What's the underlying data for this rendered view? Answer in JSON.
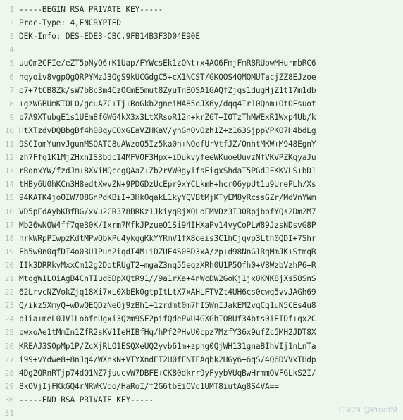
{
  "editor": {
    "lines": [
      "-----BEGIN RSA PRIVATE KEY-----",
      "Proc-Type: 4,ENCRYPTED",
      "DEK-Info: DES-EDE3-CBC,9FB14B3F3D04E90E",
      "",
      "uuQm2CFIe/eZT5pNyQ6+K1Uap/FYWcsEk1zONt+x4AO6FmjFmR8RUpwMHurmbRC6",
      "hqyoiv8vgpQgQRPYMzJ3QgS9kUCGdgC5+cX1NCST/GKQOS4QMQMUTacjZZ8EJzoe",
      "o7+7tCB8Zk/sW7b8c3m4CzOCmE5mut8ZyuTnBOSA1GAQfZjqs1dugHjZ1t17m1db",
      "+gzWGBUmKTOLO/gcuAZC+Tj+BoGkb2gneiMA85oJX6y/dqq4Ir10Qom+OtOFsuot",
      "b7A9XTubgE1s1UEm8fGW64kX3x3LtXRsoR12n+krZ6T+IOTzThMWExR1Wxp4Ub/k",
      "HtXTzdvDQBbgBf4h08qyCOxGEaVZHKaV/ynGnOvOzh1Z+z163SjppVPKO7H4bdLg",
      "9SCIomYunvJgunMSOATC8uAWzoQ5Iz5ka0h+NOofUrVtfJZ/OnhtMKW+M948EgnY",
      "zh7Ffq1K1MjZHxnIS3bdc14MFVOF3Hpx+iDukvyfeeWKuoeUuvzNfVKVPZKqyaJu",
      "rRqnxYW/fzdJm+8XViMQccgQAaZ+Zb2rVW0gyifsEigxShdaT5PGdJFKKVLS+bD1",
      "tHBy6U0hKCn3H8edtXwvZN+9PDGDzUcEpr9xYCLkmH+hcr06ypUt1u9UrePLh/Xs",
      "94KATK4joOIW7O8GnPdKBiI+3Hk0qakL1kyYQVBtMjKTyEM8yRcssGZr/MdVnYWm",
      "VD5pEdAybKBfBG/xVu2CR378BRKz1JkiyqRjXQLoFMVDz3I30RpjbpfYQs2Dm2M7",
      "Mb26wNQW4ff7qe30K/Ixrm7MfkJPzueQ1Si94IHXaPv14vyCoPLW89JzsNDsvG8P",
      "hrkWRpPIwpzKdtMPwQbkPu4ykqgKkYYRmV1fX8oeis3C1hCjqvp3Lth0QDI+7Shr",
      "Fb5w0n0qfDT4o03U1Pun2iqdI4M+iDZUF4S0BD3xA/zp+d98NnG1RqMmJK+StmqR",
      "IIk3DRRkvMxxCm12g2DotRUgT2+mgaZ3nq55eqzXRh0U1P5Qfh0+V8WzbVzhP6+R",
      "MtqgW1L0iAgB4CnTIud6DpXQtR91//9a1rXa+4nWcDW2GoKj1jx0KNK8jXs58SnS",
      "62LrvcNZVokZjq18Xi7xL0XbEk0gtpItLtX7xAHLFTVZt4UH6cs0cwq5vvJAGh69",
      "Q/ikz5XmyQ+wDwQEQDzNeOj9zBh1+1zrdmt0m7hI5WnIJakEM2vqCq1uN5CEs4u8",
      "p1ia+meL0JV1LobfnUgxi3Qzm9SF2pifQdePVU4GXGhIOBUf34bts0iEIDf+qx2C",
      "pwxoAe1tMmIn1ZfR2sKV1IeHIBfHq/hPf2PHvU0cpz7MzfY36x9ufZc5MH2JDT8X",
      "KREAJ3S0pMp1P/ZcXjRLO1ESQXeUQ2yvb61m+zphg0QjWH131gnaBIhVIj1nLnTa",
      "i99+vYdwe8+8nJq4/WXnkN+VTYXndET2H0fFNTFAqbk2HGy6+6qS/4Q6DVVxTHdp",
      "4Dg2QRnRTjp74dQ1NZ7juucvW7DBFE+CK80dkrr9yFyybVUqBwHrmmQVFGLkS2I/",
      "8kOVjIjFKkGQ4rNRWKVoo/HaRoI/f2G6tbEiOVc1UMT8iutAg8S4VA==",
      "-----END RSA PRIVATE KEY-----",
      ""
    ]
  },
  "watermark": "CSDN @ProofM"
}
